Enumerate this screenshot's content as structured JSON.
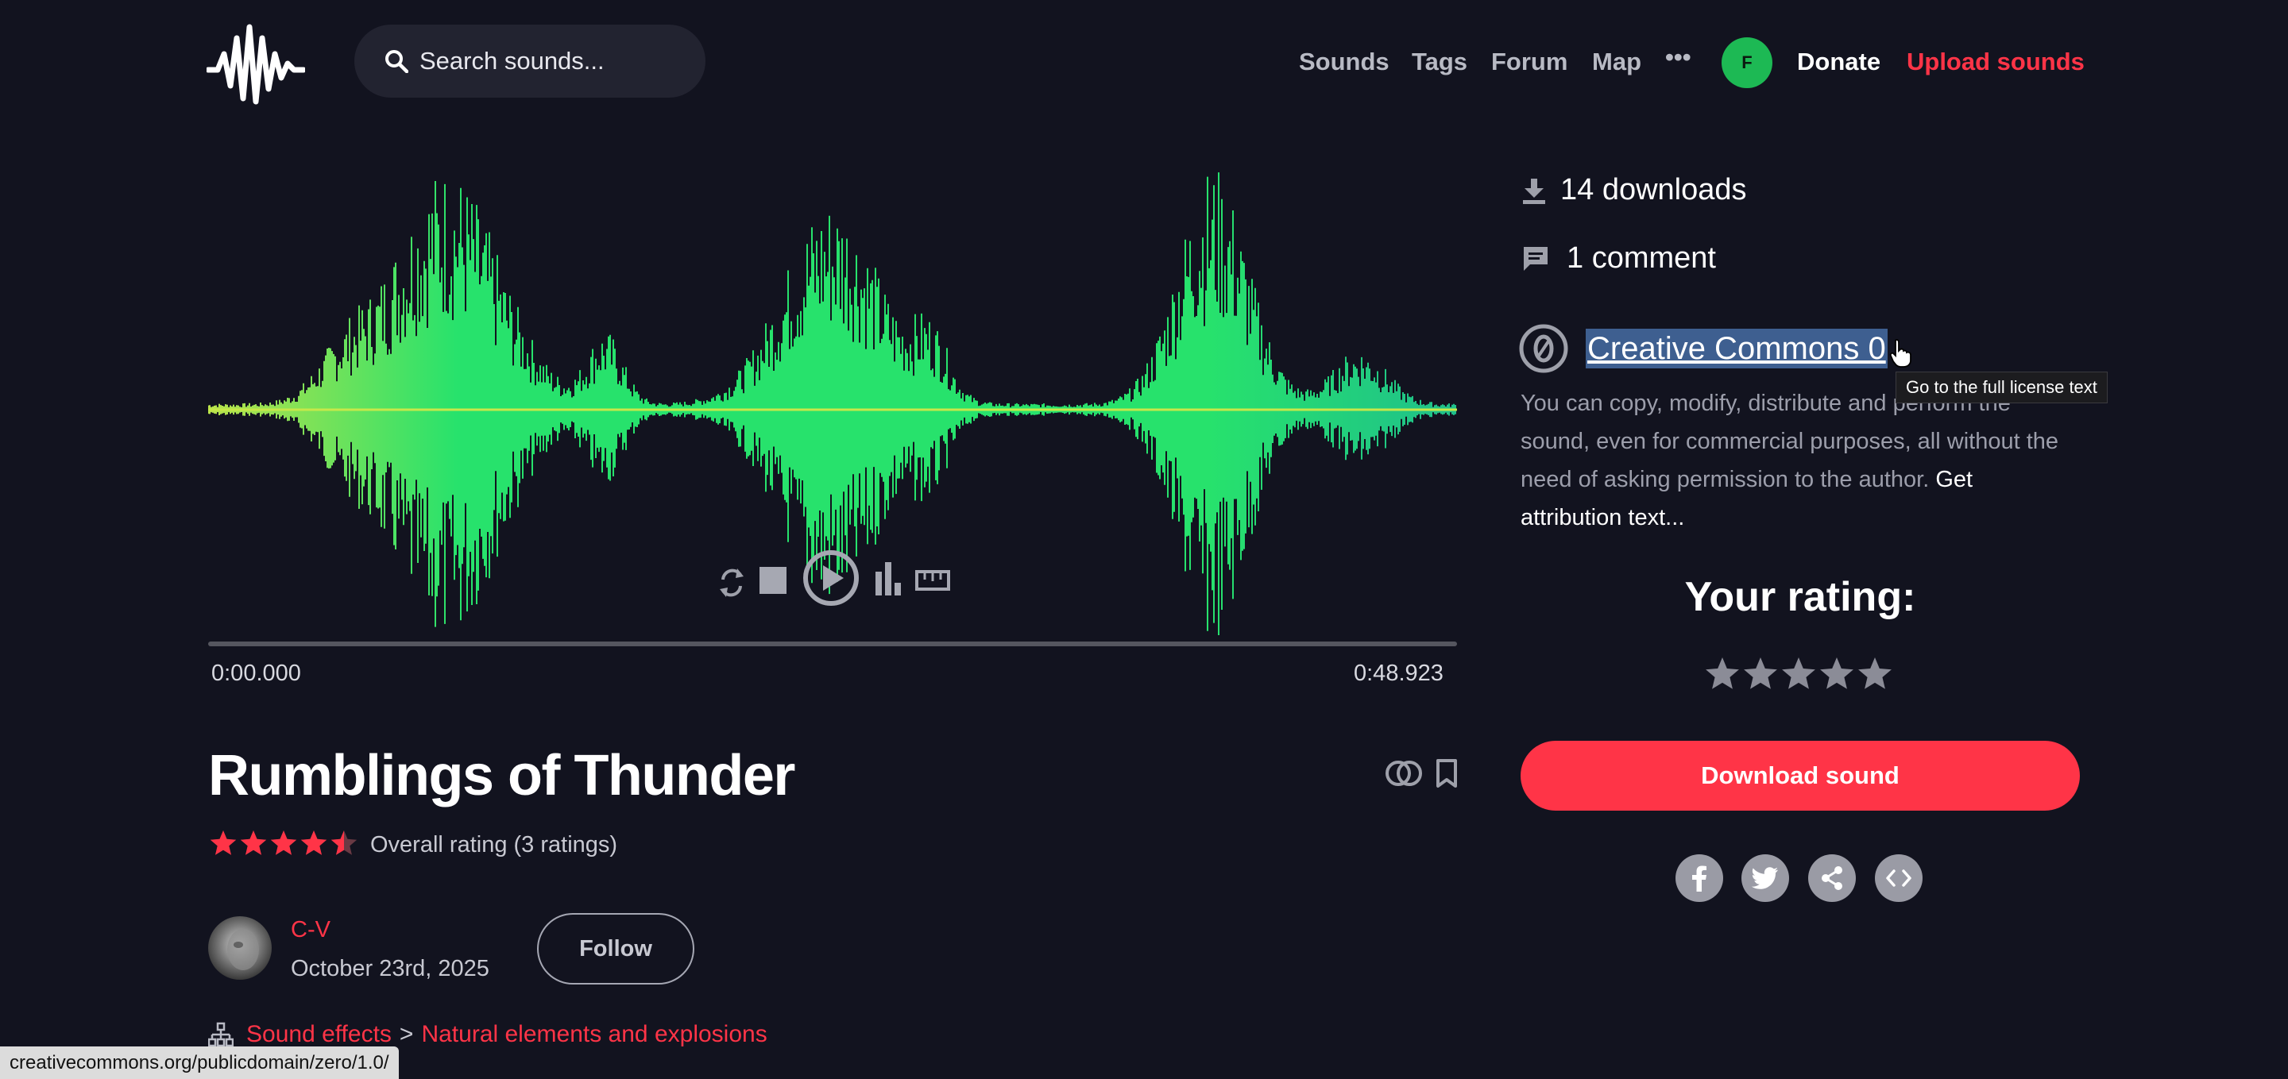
{
  "header": {
    "search_placeholder": "Search sounds...",
    "nav": [
      "Sounds",
      "Tags",
      "Forum",
      "Map",
      "•••"
    ],
    "avatar_initial": "F",
    "donate": "Donate",
    "upload": "Upload sounds"
  },
  "player": {
    "time_start": "0:00.000",
    "time_end": "0:48.923",
    "controls": [
      "loop-icon",
      "stop-icon",
      "play-icon",
      "spectrogram-icon",
      "ruler-icon"
    ],
    "progress": 0
  },
  "sound": {
    "title": "Rumblings of Thunder",
    "rating_stars": 4.5,
    "rating_text": "Overall rating (3 ratings)",
    "username": "C-V",
    "date": "October 23rd, 2025",
    "follow": "Follow",
    "category": "Sound effects",
    "category_sep": ">",
    "subcategory": "Natural elements and explosions"
  },
  "sidebar": {
    "downloads": "14 downloads",
    "comments": "1 comment",
    "license": "Creative Commons 0",
    "tooltip": "Go to the full license text",
    "license_desc": "You can copy, modify, distribute and perform the sound, even for commercial purposes, all without the need of asking permission to the author.",
    "attribution": "Get attribution text...",
    "your_rating": "Your rating:",
    "user_rating": 0,
    "download": "Download sound",
    "share": [
      "facebook-icon",
      "twitter-icon",
      "share-icon",
      "embed-icon"
    ]
  },
  "status_bar": "creativecommons.org/publicdomain/zero/1.0/",
  "colors": {
    "background": "#12131f",
    "accent": "#ff3447",
    "waveform": "#27e26c",
    "avatar": "#1db954"
  }
}
